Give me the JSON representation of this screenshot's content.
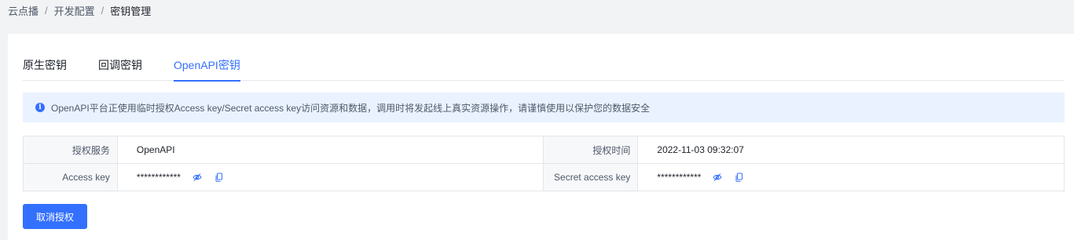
{
  "breadcrumb": {
    "items": [
      "云点播",
      "开发配置",
      "密钥管理"
    ],
    "separator": "/"
  },
  "tabs": [
    {
      "label": "原生密钥",
      "active": false
    },
    {
      "label": "回调密钥",
      "active": false
    },
    {
      "label": "OpenAPI密钥",
      "active": true
    }
  ],
  "notice": {
    "icon": "info-icon",
    "text": "OpenAPI平台正使用临时授权Access key/Secret access key访问资源和数据，调用时将发起线上真实资源操作，请谨慎使用以保护您的数据安全"
  },
  "auth_table": {
    "service_label": "授权服务",
    "service_value": "OpenAPI",
    "time_label": "授权时间",
    "time_value": "2022-11-03 09:32:07",
    "access_key_label": "Access key",
    "access_key_value": "************",
    "secret_key_label": "Secret access key",
    "secret_key_value": "************"
  },
  "actions": {
    "revoke_label": "取消授权"
  },
  "colors": {
    "accent": "#3370ff",
    "notice_bg": "#eaf2ff"
  }
}
